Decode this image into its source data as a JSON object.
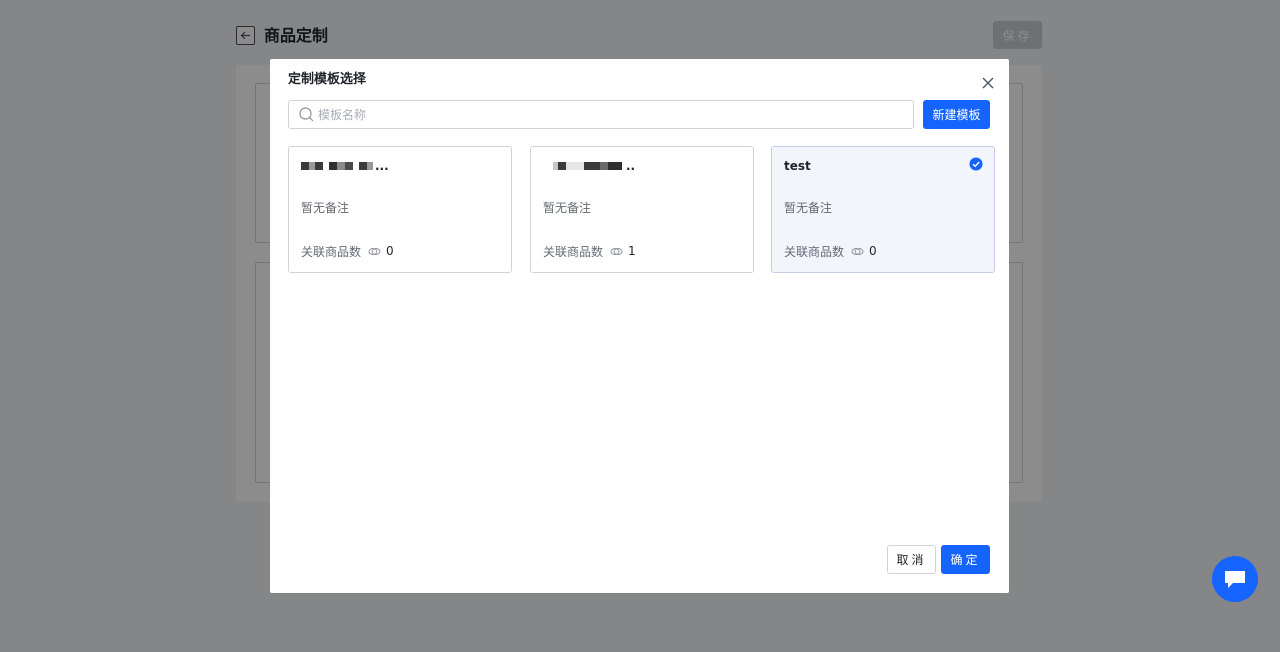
{
  "page": {
    "title": "商品定制",
    "save_label": "保存",
    "back_icon": "arrow-left-icon"
  },
  "modal": {
    "title": "定制模板选择",
    "close_icon": "close-icon",
    "search": {
      "placeholder": "模板名称",
      "value": "",
      "icon": "search-icon"
    },
    "new_template_label": "新建模板",
    "linked_label": "关联商品数",
    "templates": [
      {
        "name": "",
        "name_redacted": true,
        "note": "暂无备注",
        "linked_count": "0",
        "selected": false
      },
      {
        "name": "",
        "name_redacted": true,
        "note": "暂无备注",
        "linked_count": "1",
        "selected": false
      },
      {
        "name": "test",
        "name_redacted": false,
        "note": "暂无备注",
        "linked_count": "0",
        "selected": true
      }
    ],
    "cancel_label": "取消",
    "confirm_label": "确定"
  },
  "chat_fab": {
    "icon": "chat-bubble-icon"
  },
  "colors": {
    "primary": "#1664ff",
    "selected_card_bg": "#f3f5fd",
    "overlay": "rgba(0,0,0,0.45)"
  }
}
